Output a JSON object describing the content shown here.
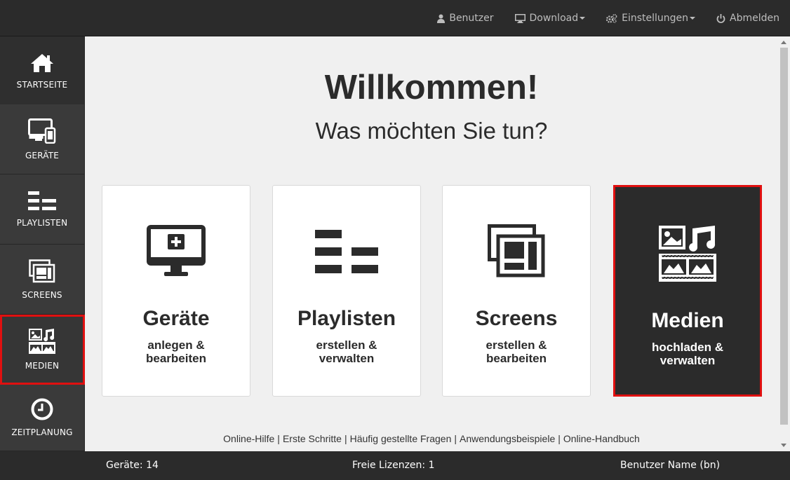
{
  "topnav": {
    "user": "Benutzer",
    "download": "Download",
    "settings": "Einstellungen",
    "logout": "Abmelden"
  },
  "sidebar": {
    "items": [
      {
        "label": "STARTSEITE",
        "icon": "home-icon"
      },
      {
        "label": "GERÄTE",
        "icon": "devices-icon"
      },
      {
        "label": "PLAYLISTEN",
        "icon": "playlist-icon"
      },
      {
        "label": "SCREENS",
        "icon": "screens-icon"
      },
      {
        "label": "MEDIEN",
        "icon": "media-icon"
      },
      {
        "label": "ZEITPLANUNG",
        "icon": "clock-icon"
      }
    ],
    "active": "MEDIEN"
  },
  "main": {
    "title": "Willkommen!",
    "subtitle": "Was möchten Sie tun?",
    "cards": [
      {
        "title": "Geräte",
        "desc": "anlegen &\nbearbeiten",
        "icon": "monitor-add-icon"
      },
      {
        "title": "Playlisten",
        "desc": "erstellen &\nverwalten",
        "icon": "playlist-icon"
      },
      {
        "title": "Screens",
        "desc": "erstellen &\nbearbeiten",
        "icon": "screens-icon"
      },
      {
        "title": "Medien",
        "desc": "hochladen &\nverwalten",
        "icon": "media-icon"
      }
    ],
    "links": [
      "Online-Hilfe",
      "Erste Schritte",
      "Häufig gestellte Fragen",
      "Anwendungsbeispiele",
      "Online-Handbuch"
    ]
  },
  "status": {
    "devices": "Geräte: 14",
    "licenses": "Freie Lizenzen: 1",
    "user": "Benutzer Name (bn)"
  },
  "colors": {
    "dark": "#2b2b2b",
    "highlight": "#e01010",
    "background": "#f0f0f0"
  }
}
